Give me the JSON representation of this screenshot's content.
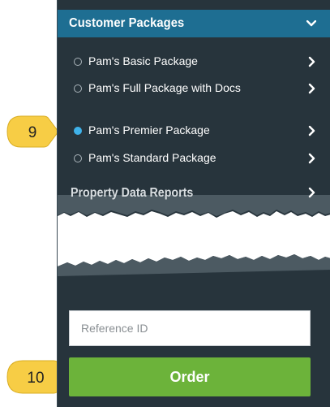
{
  "section": {
    "title": "Customer Packages",
    "expanded": true
  },
  "packages": [
    {
      "label": "Pam's Basic Package",
      "selected": false
    },
    {
      "label": "Pam's Full Package with Docs",
      "selected": false
    },
    {
      "label": "Pam's Premier Package",
      "selected": true
    },
    {
      "label": "Pam's Standard Package",
      "selected": false
    }
  ],
  "reports": {
    "title": "Property Data Reports"
  },
  "reference": {
    "placeholder": "Reference ID",
    "value": ""
  },
  "order": {
    "label": "Order"
  },
  "callouts": [
    {
      "number": "9"
    },
    {
      "number": "10"
    }
  ],
  "colors": {
    "panel": "#27343c",
    "header": "#1e6e92",
    "selected": "#3fb2ea",
    "order": "#6cb33a",
    "callout": "#f7cd45"
  },
  "icons": {
    "expand": "chevron-down-icon",
    "item_arrow": "chevron-right-icon"
  }
}
